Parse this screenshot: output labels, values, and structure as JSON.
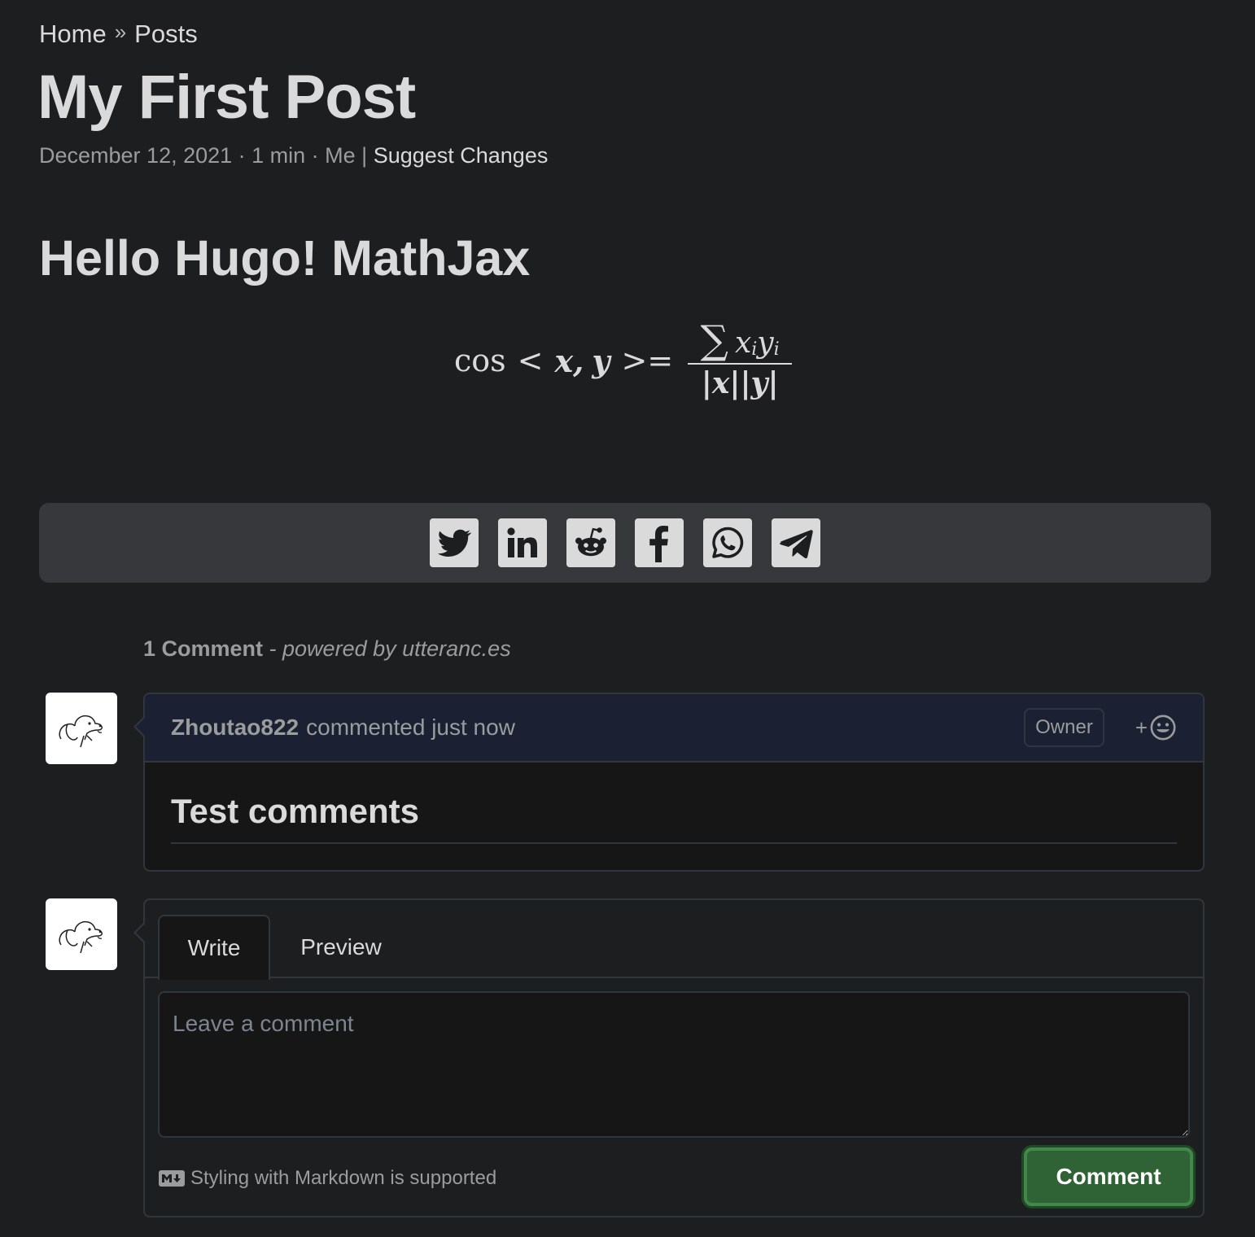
{
  "breadcrumb": {
    "home": "Home",
    "separator": "»",
    "current": "Posts"
  },
  "post": {
    "title": "My First Post",
    "meta": "December 12, 2021 · 1 min · Me | ",
    "suggest_changes": "Suggest Changes",
    "heading": "Hello Hugo! MathJax"
  },
  "formula": {
    "cos": "cos",
    "lt": "<",
    "x": "x",
    "comma": ",",
    "y": "y",
    "gteq": ">=",
    "sum": "∑",
    "xi": "x",
    "i1": "i",
    "yi": "y",
    "i2": "i",
    "den_x": "|x|",
    "den_y": "|y|"
  },
  "share": {
    "buttons": [
      {
        "icon": "twitter-icon"
      },
      {
        "icon": "linkedin-icon"
      },
      {
        "icon": "reddit-icon"
      },
      {
        "icon": "facebook-icon"
      },
      {
        "icon": "whatsapp-icon"
      },
      {
        "icon": "telegram-icon"
      }
    ],
    "background": "#37383c",
    "icon_color": "#dadadb"
  },
  "comments": {
    "count": "1 Comment",
    "powered_by": " - powered by utteranc.es",
    "items": [
      {
        "author": "Zhoutao822",
        "action": "commented just now",
        "badge": "Owner",
        "reaction": "+",
        "body": "Test comments"
      }
    ]
  },
  "editor": {
    "tab_write": "Write",
    "tab_preview": "Preview",
    "placeholder": "Leave a comment",
    "markdown_note": "Styling with Markdown is supported",
    "submit": "Comment"
  },
  "colors": {
    "page_bg": "#1d1e20",
    "comment_header_bg": "#1b2132",
    "button_green": "#2f6235",
    "text_primary": "#dadadb",
    "text_secondary": "#9b9c9d"
  }
}
